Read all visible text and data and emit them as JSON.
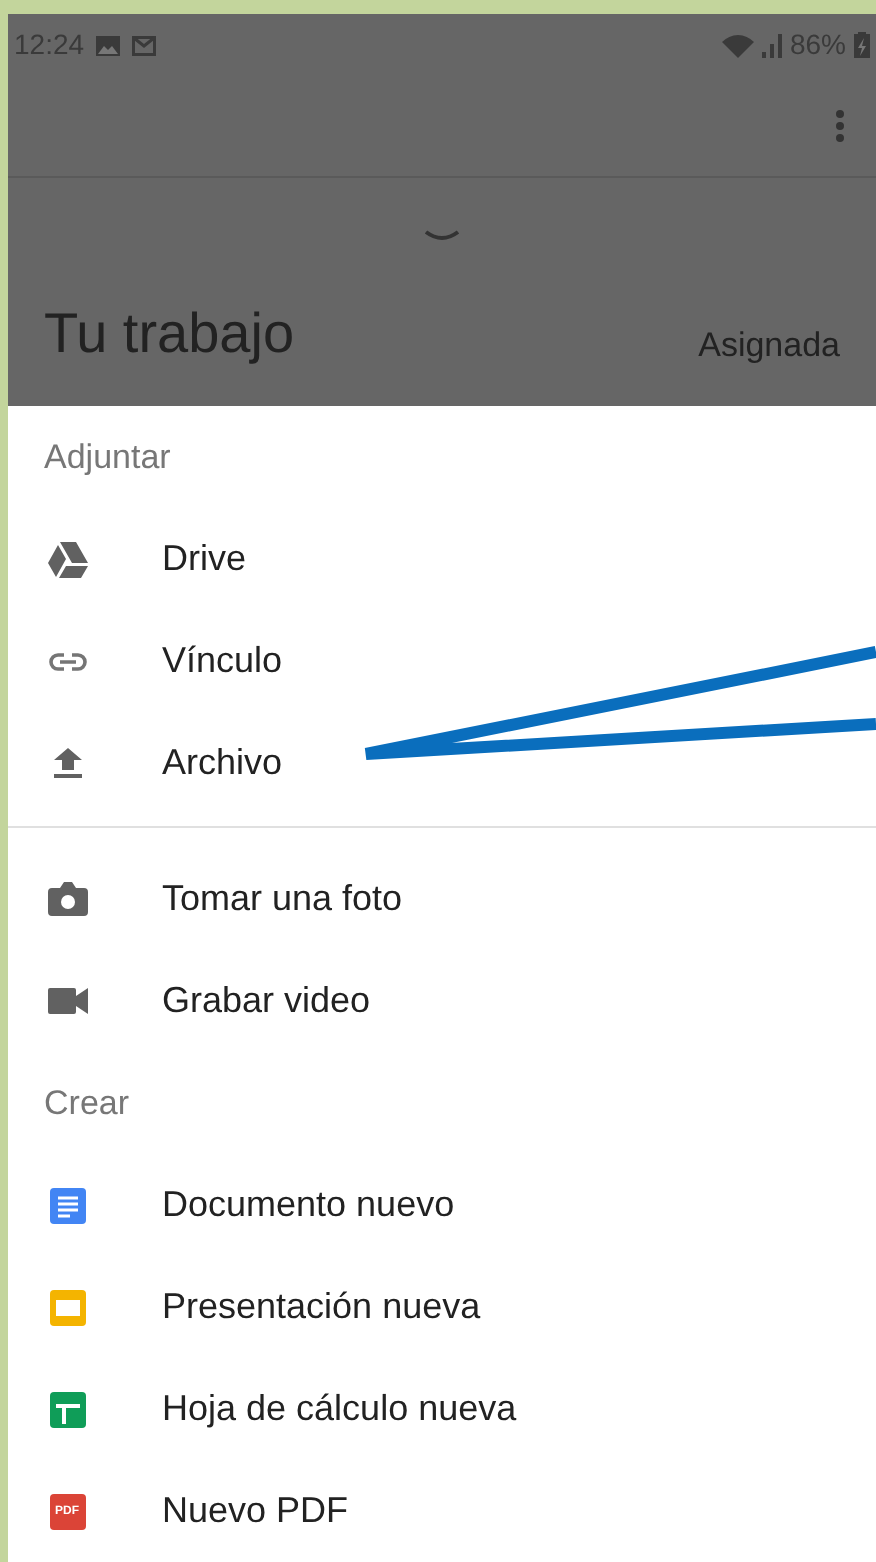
{
  "status_bar": {
    "time": "12:24",
    "battery": "86%"
  },
  "page": {
    "title": "Tu trabajo",
    "status": "Asignada"
  },
  "sheet": {
    "sections": [
      {
        "header": "Adjuntar",
        "items": [
          {
            "kind": "drive",
            "label": "Drive"
          },
          {
            "kind": "link",
            "label": "Vínculo"
          },
          {
            "kind": "upload",
            "label": "Archivo"
          }
        ]
      },
      {
        "items": [
          {
            "kind": "camera",
            "label": "Tomar una foto"
          },
          {
            "kind": "video",
            "label": "Grabar video"
          }
        ]
      },
      {
        "header": "Crear",
        "items": [
          {
            "kind": "doc",
            "label": "Documento nuevo"
          },
          {
            "kind": "slides",
            "label": "Presentación nueva"
          },
          {
            "kind": "sheet",
            "label": "Hoja de cálculo nueva"
          },
          {
            "kind": "pdf",
            "label": "Nuevo PDF",
            "icon_text": "PDF"
          }
        ]
      }
    ]
  }
}
